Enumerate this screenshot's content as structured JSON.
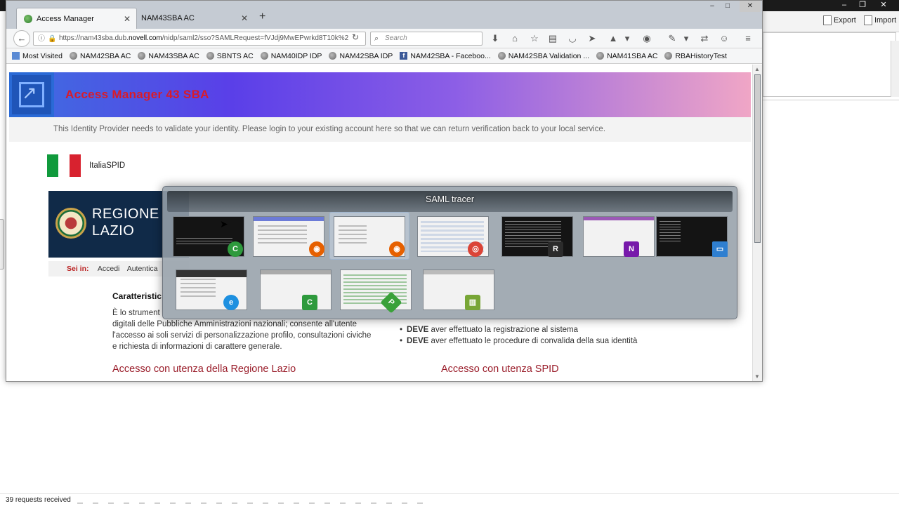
{
  "browser": {
    "tabs": [
      {
        "label": "Access Manager",
        "active": true
      },
      {
        "label": "NAM43SBA AC",
        "active": false
      }
    ],
    "url": "https://nam43sba.dub.novell.com/nidp/saml2/sso?SAMLRequest=fVJdj9MwEPwrkd8T10k%2",
    "url_prefix": "https://nam43sba.dub.",
    "url_domain": "novell.com",
    "url_suffix": "/nidp/saml2/sso?SAMLRequest=fVJdj9MwEPwrkd8T10k%2",
    "search_placeholder": "Search",
    "bookmarks": [
      "Most Visited",
      "NAM42SBA AC",
      "NAM43SBA AC",
      "SBNTS AC",
      "NAM40IDP IDP",
      "NAM42SBA IDP",
      "NAM42SBA - Faceboo...",
      "NAM42SBA Validation ...",
      "NAM41SBA AC",
      "RBAHistoryTest"
    ]
  },
  "background_app": {
    "export_label": "Export",
    "import_label": "Import"
  },
  "page": {
    "banner_title": "Access Manager 43 SBA",
    "notice": "This Identity Provider needs to validate your identity. Please login to your existing account here so that we can return verification back to your local service.",
    "flag_label": "ItaliaSPID",
    "region_line1": "REGIONE",
    "region_line2": "LAZIO",
    "breadcrumb_label": "Sei in:",
    "breadcrumb_items": [
      "Accedi",
      "Autentica"
    ],
    "left_title": "Caratteristic",
    "left_text_line1": "È lo strument",
    "left_text_line2": "digitali delle Pubbliche Amministrazioni nazionali; consente all'utente",
    "left_text_line3": "l'accesso ai soli servizi di personalizzazione profilo, consultazioni civiche",
    "left_text_line4": "e richiesta di informazioni di carattere generale.",
    "right_list": [
      {
        "bold": "DEVE",
        "text": " aver effettuato la registrazione al sistema"
      },
      {
        "bold": "DEVE",
        "text": " aver effettuato le procedure di convalida della sua identità"
      }
    ],
    "heading_left": "Accesso con utenza della Regione Lazio",
    "heading_right": "Accesso con utenza SPID"
  },
  "switcher": {
    "title": "SAML tracer",
    "items": [
      {
        "app": "camtasia-recorder"
      },
      {
        "app": "firefox"
      },
      {
        "app": "firefox",
        "selected": true
      },
      {
        "app": "chrome"
      },
      {
        "app": "remote-terminal"
      },
      {
        "app": "onenote"
      },
      {
        "app": "desktop"
      },
      {
        "app": "internet-explorer"
      },
      {
        "app": "camtasia"
      },
      {
        "app": "notepad-plus"
      },
      {
        "app": "chart-app"
      }
    ]
  },
  "status": {
    "text": "39 requests received"
  },
  "colors": {
    "banner_title": "#d81b2a",
    "section_heading": "#9a1d2a",
    "region_bg": "#102a48"
  }
}
